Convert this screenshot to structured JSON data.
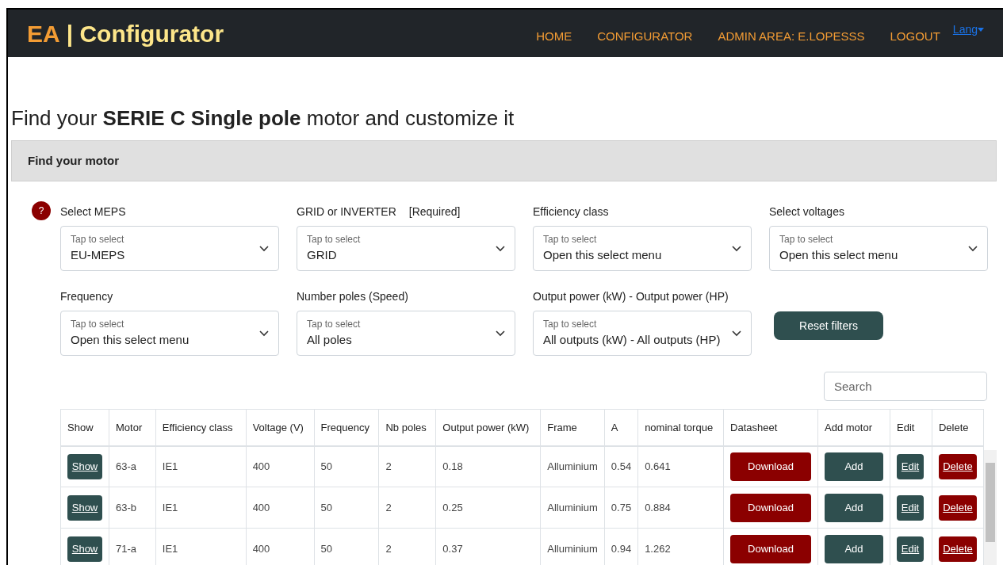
{
  "navbar": {
    "brand_prefix": "EA",
    "brand_name": "| Configurator",
    "links": [
      "HOME",
      "CONFIGURATOR",
      "ADMIN AREA: E.LOPESSS",
      "LOGOUT"
    ],
    "lang": "Lang"
  },
  "heading": "Find your **SERIE C Single pole** motor and customize it",
  "card": {
    "title": "Find your motor",
    "help": "?",
    "filters": [
      {
        "label": "Select MEPS",
        "hint": "Tap to select",
        "value": "EU-MEPS"
      },
      {
        "label": "GRID or INVERTER",
        "note": "[Required]",
        "hint": "Tap to select",
        "value": "GRID"
      },
      {
        "label": "Efficiency class",
        "hint": "Tap to select",
        "value": "Open this select menu"
      },
      {
        "label": "Select voltages",
        "hint": "Tap to select",
        "value": "Open this select menu"
      },
      {
        "label": "Frequency",
        "hint": "Tap to select",
        "value": "Open this select menu"
      },
      {
        "label": "Number poles (Speed)",
        "hint": "Tap to select",
        "value": "All poles"
      },
      {
        "label": "Output power (kW) - Output power (HP)",
        "hint": "Tap to select",
        "value": "All outputs (kW) - All outputs (HP)"
      }
    ],
    "reset": "Reset filters",
    "search": {
      "placeholder": "Search"
    },
    "table": {
      "columns": [
        "Show",
        "Motor",
        "Efficiency class",
        "Voltage (V)",
        "Frequency",
        "Nb poles",
        "Output power (kW)",
        "Frame",
        "A",
        "nominal torque",
        "Datasheet",
        "Add motor",
        "Edit",
        "Delete"
      ],
      "rows": [
        {
          "cells": [
            {
              "kind": "show",
              "text": "Show"
            },
            {
              "kind": "text",
              "text": "63-a"
            },
            {
              "kind": "text",
              "text": "IE1"
            },
            {
              "kind": "text",
              "text": "400"
            },
            {
              "kind": "text",
              "text": "50"
            },
            {
              "kind": "text",
              "text": "2"
            },
            {
              "kind": "text",
              "text": "0.18"
            },
            {
              "kind": "text",
              "text": "Alluminium"
            },
            {
              "kind": "text",
              "text": "0.54"
            },
            {
              "kind": "text",
              "text": "0.641"
            },
            {
              "kind": "download",
              "text": "Download"
            },
            {
              "kind": "add",
              "text": "Add"
            },
            {
              "kind": "edit",
              "text": "Edit"
            },
            {
              "kind": "delete",
              "text": "Delete"
            }
          ]
        },
        {
          "cells": [
            {
              "kind": "show",
              "text": "Show"
            },
            {
              "kind": "text",
              "text": "63-b"
            },
            {
              "kind": "text",
              "text": "IE1"
            },
            {
              "kind": "text",
              "text": "400"
            },
            {
              "kind": "text",
              "text": "50"
            },
            {
              "kind": "text",
              "text": "2"
            },
            {
              "kind": "text",
              "text": "0.25"
            },
            {
              "kind": "text",
              "text": "Alluminium"
            },
            {
              "kind": "text",
              "text": "0.75"
            },
            {
              "kind": "text",
              "text": "0.884"
            },
            {
              "kind": "download",
              "text": "Download"
            },
            {
              "kind": "add",
              "text": "Add"
            },
            {
              "kind": "edit",
              "text": "Edit"
            },
            {
              "kind": "delete",
              "text": "Delete"
            }
          ]
        },
        {
          "cells": [
            {
              "kind": "show",
              "text": "Show"
            },
            {
              "kind": "text",
              "text": "71-a"
            },
            {
              "kind": "text",
              "text": "IE1"
            },
            {
              "kind": "text",
              "text": "400"
            },
            {
              "kind": "text",
              "text": "50"
            },
            {
              "kind": "text",
              "text": "2"
            },
            {
              "kind": "text",
              "text": "0.37"
            },
            {
              "kind": "text",
              "text": "Alluminium"
            },
            {
              "kind": "text",
              "text": "0.94"
            },
            {
              "kind": "text",
              "text": "1.262"
            },
            {
              "kind": "download",
              "text": "Download"
            },
            {
              "kind": "add",
              "text": "Add"
            },
            {
              "kind": "edit",
              "text": "Edit"
            },
            {
              "kind": "delete",
              "text": "Delete"
            }
          ]
        }
      ]
    }
  }
}
